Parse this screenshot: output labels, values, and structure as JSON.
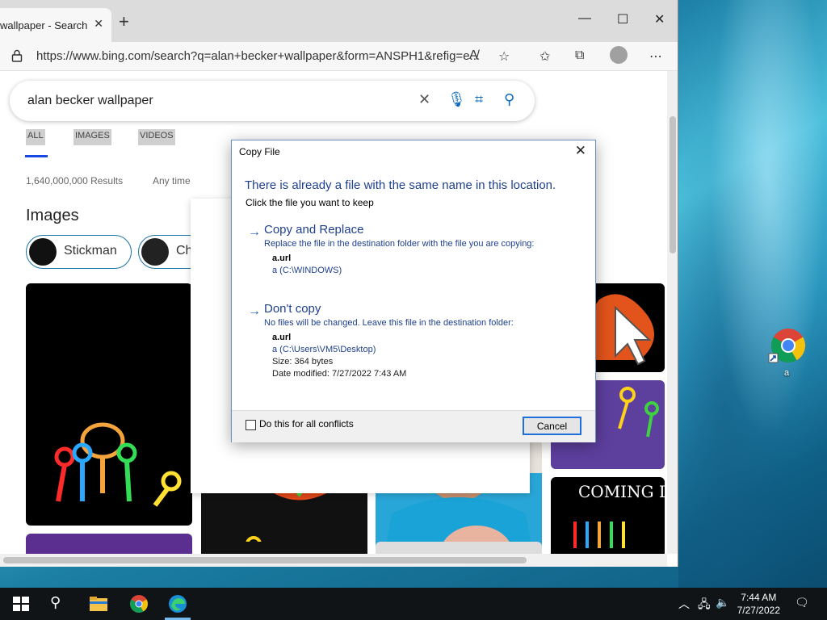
{
  "browser": {
    "tab_title": "wallpaper - Search",
    "url": "https://www.bing.com/search?q=alan+becker+wallpaper&form=ANSPH1&refig=e..."
  },
  "search": {
    "query": "alan becker wallpaper",
    "tabs": [
      "ALL",
      "IMAGES",
      "VIDEOS"
    ],
    "results_count": "1,640,000,000 Results",
    "any_time": "Any time",
    "images_heading": "Images",
    "chips": [
      "Stickman",
      "Ch"
    ],
    "coming_text": "COMING DEC"
  },
  "dialog": {
    "title": "Copy File",
    "heading": "There is already a file with the same name in this location.",
    "subheading": "Click the file you want to keep",
    "option1": {
      "title": "Copy and Replace",
      "desc": "Replace the file in the destination folder with the file you are copying:",
      "file_name": "a.url",
      "file_path": "a (C:\\WINDOWS)"
    },
    "option2": {
      "title": "Don't copy",
      "desc": "No files will be changed. Leave this file in the destination folder:",
      "file_name": "a.url",
      "file_path": "a (C:\\Users\\VM5\\Desktop)",
      "size": "Size: 364 bytes",
      "modified": "Date modified: 7/27/2022 7:43 AM"
    },
    "checkbox_label": "Do this for all conflicts",
    "cancel_label": "Cancel"
  },
  "desktop": {
    "icon_label": "a"
  },
  "taskbar": {
    "time": "7:44 AM",
    "date": "7/27/2022"
  },
  "colors": {
    "accent": "#1e6fd9",
    "dialog_text": "#1e3f8f",
    "bing_blue": "#0f6cbd"
  }
}
